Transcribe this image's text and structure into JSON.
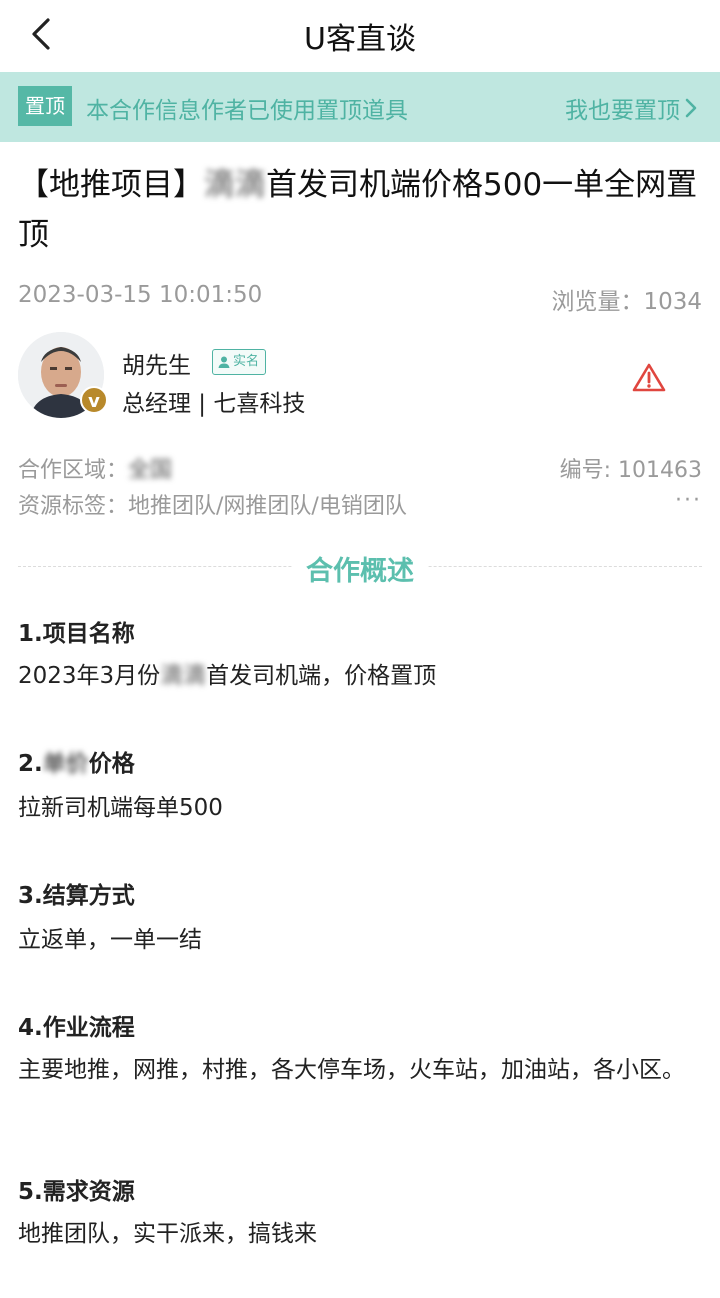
{
  "nav": {
    "title": "U客直谈"
  },
  "pin_bar": {
    "tag": "置顶",
    "message": "本合作信息作者已使用置顶道具",
    "cta": "我也要置顶"
  },
  "post": {
    "title_prefix": "【地推项目】",
    "title_blurred": "滴滴",
    "title_suffix": "首发司机端价格500一单全网置顶",
    "date": "2023-03-15 10:01:50",
    "views": "浏览量：1034"
  },
  "author": {
    "name": "胡先生",
    "verified": "实名",
    "role": "总经理 | 七喜科技",
    "badge": "v"
  },
  "info": {
    "region_label": "合作区域：",
    "region_blurred": "全国",
    "number": "编号: 101463",
    "tags_label": "资源标签：",
    "tags": "地推团队/网推团队/电销团队",
    "more": "···"
  },
  "overview": {
    "title": "合作概述",
    "sections": [
      {
        "h": "1.项目名称",
        "p_pre": "2023年3月份",
        "p_blur": "滴滴",
        "p_post": "首发司机端，价格置顶"
      },
      {
        "h_pre": "2.",
        "h_blur": "单价",
        "h_post": "价格",
        "p": "拉新司机端每单500"
      },
      {
        "h": "3.结算方式",
        "p": "立返单，一单一结"
      },
      {
        "h": "4.作业流程",
        "p": "主要地推，网推，村推，各大停车场，火车站，加油站，各小区。"
      },
      {
        "h": "5.需求资源",
        "p": "地推团队，实干派来，搞钱来"
      }
    ]
  },
  "icons": {
    "back": "chevron-left-icon",
    "cta_arrow": "chevron-right-icon",
    "report": "warning-triangle-icon",
    "person": "person-icon"
  },
  "colors": {
    "accent": "#4fb3a3",
    "pin_bg": "#bfe7e0",
    "tag_bg": "#55b8a6",
    "warn": "#e0463f",
    "badge": "#b8892b"
  }
}
